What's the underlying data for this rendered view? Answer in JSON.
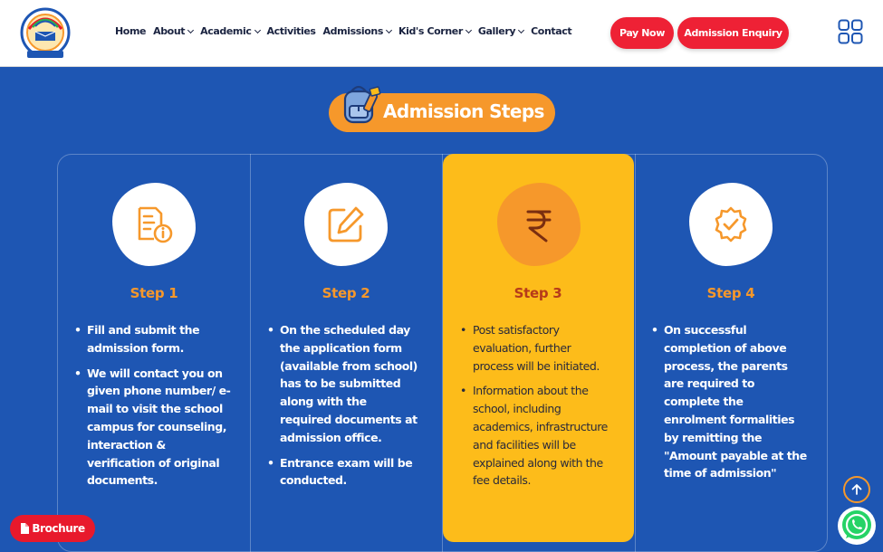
{
  "header": {
    "nav": [
      {
        "label": "Home",
        "dropdown": false
      },
      {
        "label": "About",
        "dropdown": true
      },
      {
        "label": "Academic",
        "dropdown": true
      },
      {
        "label": "Activities",
        "dropdown": false
      },
      {
        "label": "Admissions",
        "dropdown": true
      },
      {
        "label": "Kid's Corner",
        "dropdown": true
      },
      {
        "label": "Gallery",
        "dropdown": true
      },
      {
        "label": "Contact",
        "dropdown": false
      }
    ],
    "pay_now_label": "Pay Now",
    "enquiry_label": "Admission Enquiry",
    "menu_icon": "grid-icon"
  },
  "banner": {
    "title": "Admission Steps",
    "icon": "backpack-icon"
  },
  "steps": [
    {
      "title": "Step 1",
      "icon": "form-info-icon",
      "items": [
        "Fill and submit the admission form.",
        "We will contact you on given phone number/ e-mail to visit the school campus for counseling, interaction & verification of original documents."
      ]
    },
    {
      "title": "Step 2",
      "icon": "edit-icon",
      "items": [
        "On the scheduled day the application form (available from school) has to be submitted along with the required documents at admission office.",
        "Entrance exam will be conducted."
      ]
    },
    {
      "title": "Step 3",
      "icon": "rupee-icon",
      "items": [
        "Post satisfactory evaluation, further process will be initiated.",
        "Information about the school, including academics, infrastructure and facilities will be explained along with the fee details."
      ]
    },
    {
      "title": "Step 4",
      "icon": "verified-badge-icon",
      "items": [
        "On successful completion of above process, the parents are required to complete the enrolment formalities by remitting the \"Amount payable at the time of admission\""
      ]
    }
  ],
  "floating": {
    "brochure_label": "Brochure"
  },
  "colors": {
    "background": "#1e56b3",
    "accent_orange": "#f6982b",
    "accent_red": "#ee2135",
    "highlight_yellow": "#fdbc1a"
  }
}
